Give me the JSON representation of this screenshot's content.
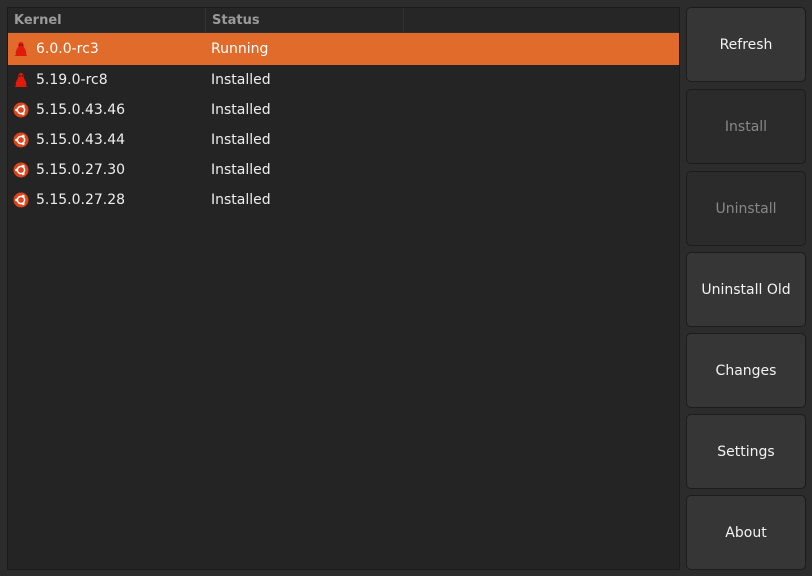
{
  "columns": {
    "kernel": "Kernel",
    "status": "Status"
  },
  "rows": [
    {
      "kernel": "6.0.0-rc3",
      "status": "Running",
      "icon": "tux-icon",
      "selected": true
    },
    {
      "kernel": "5.19.0-rc8",
      "status": "Installed",
      "icon": "tux-icon"
    },
    {
      "kernel": "5.15.0.43.46",
      "status": "Installed",
      "icon": "ubuntu-icon"
    },
    {
      "kernel": "5.15.0.43.44",
      "status": "Installed",
      "icon": "ubuntu-icon"
    },
    {
      "kernel": "5.15.0.27.30",
      "status": "Installed",
      "icon": "ubuntu-icon"
    },
    {
      "kernel": "5.15.0.27.28",
      "status": "Installed",
      "icon": "ubuntu-icon"
    }
  ],
  "buttons": {
    "refresh": "Refresh",
    "install": "Install",
    "uninstall": "Uninstall",
    "uninstall_old": "Uninstall Old",
    "changes": "Changes",
    "settings": "Settings",
    "about": "About"
  },
  "colors": {
    "selection": "#e06b2b",
    "icon": "#e01b0b"
  }
}
